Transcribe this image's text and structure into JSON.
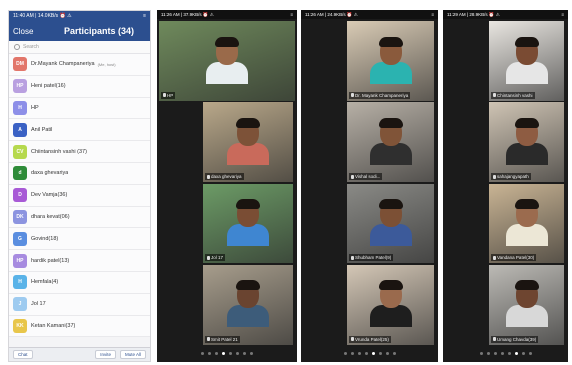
{
  "list_phone": {
    "status_time": "11:40 AM | 14.0KB/s ⏰ ⚠",
    "close_label": "Close",
    "title": "Participants (34)",
    "search_placeholder": "Search",
    "participants": [
      {
        "initials": "DM",
        "name": "Dr.Mayank Champaneriya",
        "tag": "(Me, host)",
        "color": "#e2766a"
      },
      {
        "initials": "HP",
        "name": "Heni patel(16)",
        "tag": "",
        "color": "#b9a0e0"
      },
      {
        "initials": "H",
        "name": "HP",
        "tag": "",
        "color": "#8d8fe8"
      },
      {
        "initials": "A",
        "name": "Anil Patil",
        "tag": "",
        "color": "#3a61c4"
      },
      {
        "initials": "CV",
        "name": "Chiintansinh vashi (37)",
        "tag": "",
        "color": "#b6d94e"
      },
      {
        "initials": "d",
        "name": "daxa ghevariya",
        "tag": "",
        "color": "#2f8c3a"
      },
      {
        "initials": "D",
        "name": "Dev Vamja(36)",
        "tag": "",
        "color": "#a85ad6"
      },
      {
        "initials": "DK",
        "name": "dhara kevat(06)",
        "tag": "",
        "color": "#8c94e0"
      },
      {
        "initials": "G",
        "name": "Govind(18)",
        "tag": "",
        "color": "#5a8ee0"
      },
      {
        "initials": "HP",
        "name": "hardik patel(13)",
        "tag": "",
        "color": "#a78be0"
      },
      {
        "initials": "H",
        "name": "Hemfala(4)",
        "tag": "",
        "color": "#5ab3e8"
      },
      {
        "initials": "J",
        "name": "Jol 17",
        "tag": "",
        "color": "#9ecbf0"
      },
      {
        "initials": "KK",
        "name": "Ketan Kamani(37)",
        "tag": "",
        "color": "#e8c64a"
      }
    ],
    "footer": {
      "chat": "Chat",
      "invite": "Invite",
      "mute_all": "Mute All"
    }
  },
  "video_phones": [
    {
      "status_time": "11:26 AM | 37.9KB/s ⏰ ⚠",
      "tiles": [
        {
          "name": "HP",
          "skin": "#9a6a4a",
          "shirt": "#e8eef0",
          "bg": "#6f8a5c"
        },
        {
          "name": "daxa ghevariya",
          "skin": "#7d5238",
          "shirt": "#c96a5b",
          "bg": "#b9a88a"
        },
        {
          "name": "Jol 17",
          "skin": "#7a4d34",
          "shirt": "#3f86d1",
          "bg": "#6c9b66"
        },
        {
          "name": "Smit Patel 21",
          "skin": "#6a4430",
          "shirt": "#3d5c7a",
          "bg": "#a79d8c"
        }
      ],
      "active_dot": 3
    },
    {
      "status_time": "11:26 AM | 24.9KB/s ⏰ ⚠",
      "tiles": [
        {
          "name": "Dr. Mayank Champaneriya",
          "skin": "#8a5a3c",
          "shirt": "#2bb3b0",
          "bg": "#d9cbb5"
        },
        {
          "name": "Vishal sodi...",
          "skin": "#805438",
          "shirt": "#2f2f2f",
          "bg": "#b7b0a6"
        },
        {
          "name": "Shubham Patel(9)",
          "skin": "#7c5035",
          "shirt": "#3c5a9a",
          "bg": "#8a8a86"
        },
        {
          "name": "Vrunda Patel(25)",
          "skin": "#9a6a4d",
          "shirt": "#1e1e1e",
          "bg": "#d4c7b6"
        }
      ],
      "active_dot": 4
    },
    {
      "status_time": "11:29 AM | 28.9KB/s ⏰ ⚠",
      "tiles": [
        {
          "name": "Chintansinh vashi",
          "skin": "#7a4b33",
          "shirt": "#e6e6e6",
          "bg": "#e9e6e1"
        },
        {
          "name": "sahajangyapath",
          "skin": "#8e5c42",
          "shirt": "#2a2a2a",
          "bg": "#cfc4b4"
        },
        {
          "name": "Vandana Patel(30)",
          "skin": "#9b6b4e",
          "shirt": "#ece7d6",
          "bg": "#c9b494"
        },
        {
          "name": "Umang Chavda(39)",
          "skin": "#6e4530",
          "shirt": "#d8d8d8",
          "bg": "#bcbab5"
        }
      ],
      "active_dot": 5
    }
  ]
}
